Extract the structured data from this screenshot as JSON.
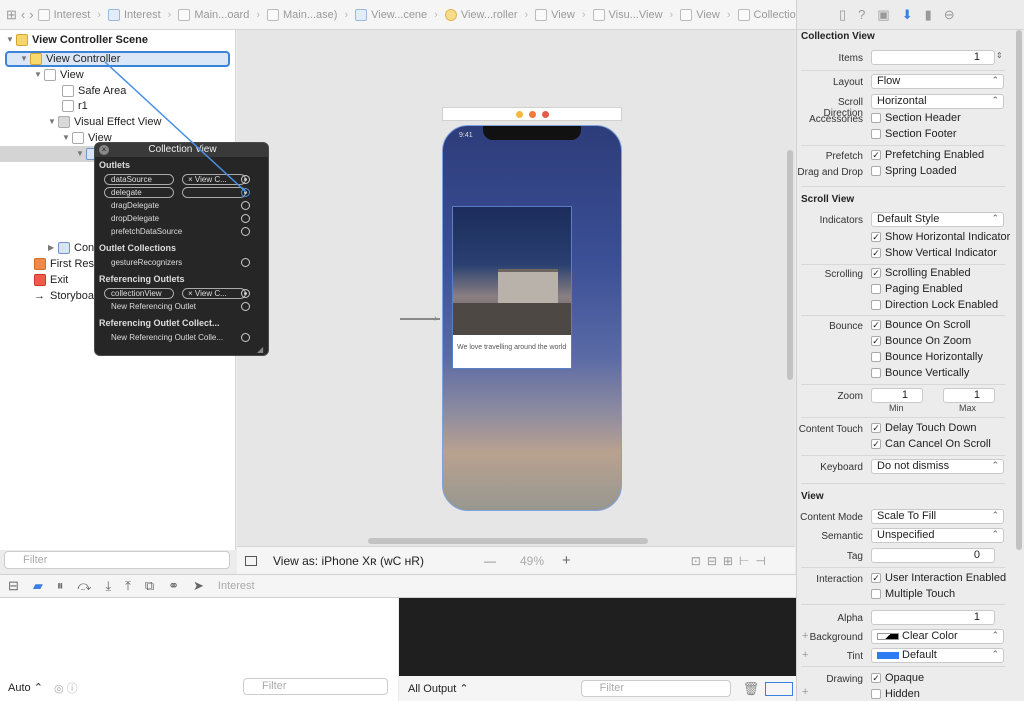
{
  "breadcrumbs": [
    "Interest",
    "Interest",
    "Main...oard",
    "Main...ase)",
    "View...cene",
    "View...roller",
    "View",
    "Visu...View",
    "View",
    "Collection View"
  ],
  "outline": {
    "scene": "View Controller Scene",
    "items": [
      "View Controller",
      "View",
      "Safe Area",
      "r1",
      "Visual Effect View",
      "View",
      "Con",
      "First Resp",
      "Exit",
      "Storyboar"
    ],
    "filter_placeholder": "Filter"
  },
  "canvas": {
    "clock": "9:41",
    "card_text": "We love travelling around the world",
    "view_as": "View as: iPhone Xʀ (ᴡC ʜR)",
    "zoom": "49%",
    "minus": "—",
    "plus": "+"
  },
  "popover": {
    "title": "Collection View",
    "outlets_header": "Outlets",
    "outlets": [
      "dataSource",
      "delegate",
      "dragDelegate",
      "dropDelegate",
      "prefetchDataSource"
    ],
    "connected_to": "View C...",
    "outlet_collections_header": "Outlet Collections",
    "gesture": "gestureRecognizers",
    "referencing_header": "Referencing Outlets",
    "referencing": "collectionView",
    "new_ref": "New Referencing Outlet",
    "ref_collection_header": "Referencing Outlet Collect...",
    "new_ref_collection": "New Referencing Outlet Colle..."
  },
  "debug": {
    "scheme": "Interest",
    "auto": "Auto",
    "vars_filter": "Filter",
    "output": "All Output",
    "console_filter": "Filter"
  },
  "inspector": {
    "collection_view": {
      "header": "Collection View",
      "items_label": "Items",
      "items_value": "1",
      "layout_label": "Layout",
      "layout_value": "Flow",
      "scroll_dir_label": "Scroll Direction",
      "scroll_dir_value": "Horizontal",
      "accessories_label": "Accessories",
      "section_header": "Section Header",
      "section_footer": "Section Footer",
      "prefetch_label": "Prefetch",
      "prefetch_value": "Prefetching Enabled",
      "dnd_label": "Drag and Drop",
      "dnd_value": "Spring Loaded"
    },
    "scroll_view": {
      "header": "Scroll View",
      "indicators_label": "Indicators",
      "indicators_value": "Default Style",
      "show_h": "Show Horizontal Indicator",
      "show_v": "Show Vertical Indicator",
      "scrolling_label": "Scrolling",
      "scrolling_enabled": "Scrolling Enabled",
      "paging": "Paging Enabled",
      "direction_lock": "Direction Lock Enabled",
      "bounce_label": "Bounce",
      "bounce_scroll": "Bounce On Scroll",
      "bounce_zoom": "Bounce On Zoom",
      "bounce_h": "Bounce Horizontally",
      "bounce_v": "Bounce Vertically",
      "zoom_label": "Zoom",
      "zoom_min": "1",
      "zoom_max": "1",
      "min_label": "Min",
      "max_label": "Max",
      "content_touch_label": "Content Touch",
      "delay_touch": "Delay Touch Down",
      "cancel_scroll": "Can Cancel On Scroll",
      "keyboard_label": "Keyboard",
      "keyboard_value": "Do not dismiss"
    },
    "view": {
      "header": "View",
      "content_mode_label": "Content Mode",
      "content_mode_value": "Scale To Fill",
      "semantic_label": "Semantic",
      "semantic_value": "Unspecified",
      "tag_label": "Tag",
      "tag_value": "0",
      "interaction_label": "Interaction",
      "user_interaction": "User Interaction Enabled",
      "multiple_touch": "Multiple Touch",
      "alpha_label": "Alpha",
      "alpha_value": "1",
      "background_label": "Background",
      "background_value": "Clear Color",
      "tint_label": "Tint",
      "tint_value": "Default",
      "drawing_label": "Drawing",
      "opaque": "Opaque",
      "hidden": "Hidden",
      "plus": "+",
      "tint_color": "#2f7bf2"
    }
  }
}
